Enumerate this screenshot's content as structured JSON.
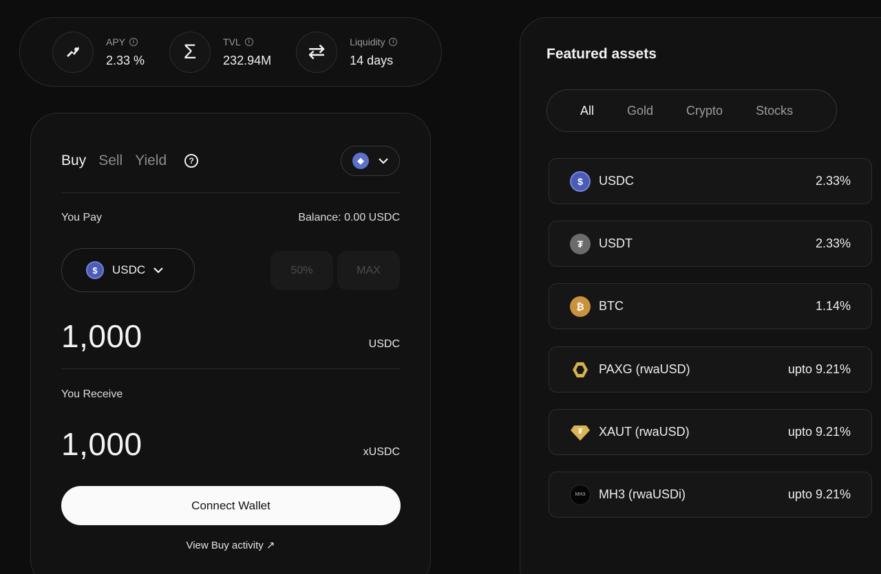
{
  "stats": [
    {
      "label": "APY",
      "value": "2.33 %",
      "icon": "rocket-icon"
    },
    {
      "label": "TVL",
      "value": "232.94M",
      "icon": "sigma-icon"
    },
    {
      "label": "Liquidity",
      "value": "14 days",
      "icon": "swap-arrows-icon"
    }
  ],
  "swap": {
    "tabs": [
      "Buy",
      "Sell",
      "Yield"
    ],
    "active_tab": "Buy",
    "you_pay_label": "You Pay",
    "balance": "Balance: 0.00 USDC",
    "pay_token": "USDC",
    "pct_50": "50%",
    "pct_max": "MAX",
    "pay_amount": "1,000",
    "pay_unit": "USDC",
    "you_receive_label": "You Receive",
    "receive_amount": "1,000",
    "receive_unit": "xUSDC",
    "connect_label": "Connect Wallet",
    "activity_label": "View Buy activity ↗"
  },
  "assets": {
    "title": "Featured assets",
    "filters": [
      "All",
      "Gold",
      "Crypto",
      "Stocks"
    ],
    "active_filter": "All",
    "items": [
      {
        "name": "USDC",
        "rate": "2.33%",
        "icon": "usdc-icon",
        "color": "#4a5bb8"
      },
      {
        "name": "USDT",
        "rate": "2.33%",
        "icon": "usdt-icon",
        "color": "#6b6b6b"
      },
      {
        "name": "BTC",
        "rate": "1.14%",
        "icon": "btc-icon",
        "color": "#c9923f"
      },
      {
        "name": "PAXG (rwaUSD)",
        "rate": "upto 9.21%",
        "icon": "paxg-icon",
        "color": "#d8b14a"
      },
      {
        "name": "XAUT (rwaUSD)",
        "rate": "upto 9.21%",
        "icon": "xaut-icon",
        "color": "#d9b556"
      },
      {
        "name": "MH3 (rwaUSDi)",
        "rate": "upto 9.21%",
        "icon": "mh3-icon",
        "color": "#0a0a0a"
      }
    ]
  }
}
